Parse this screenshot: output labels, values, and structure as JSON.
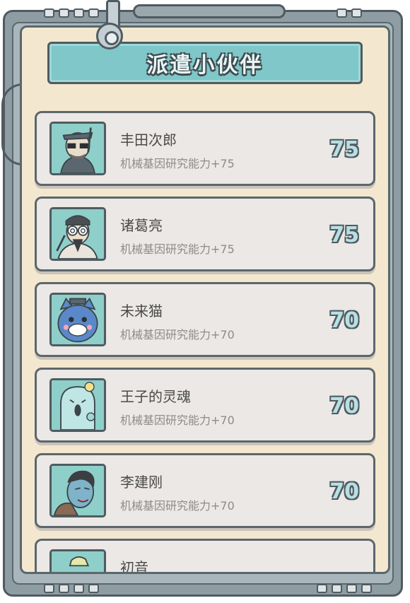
{
  "title": "派遣小伙伴",
  "partners": [
    {
      "name": "丰田次郎",
      "skill": "机械基因研究能力+75",
      "score": "75",
      "avatar": "sunglasses-man-avatar"
    },
    {
      "name": "诸葛亮",
      "skill": "机械基因研究能力+75",
      "score": "75",
      "avatar": "spiral-glasses-man-avatar"
    },
    {
      "name": "未来猫",
      "skill": "机械基因研究能力+70",
      "score": "70",
      "avatar": "blue-cat-avatar"
    },
    {
      "name": "王子的灵魂",
      "skill": "机械基因研究能力+70",
      "score": "70",
      "avatar": "ghost-avatar"
    },
    {
      "name": "李建刚",
      "skill": "机械基因研究能力+70",
      "score": "70",
      "avatar": "blue-face-man-avatar"
    },
    {
      "name": "初音",
      "skill": "",
      "score": "",
      "avatar": "green-hair-girl-avatar"
    }
  ],
  "colors": {
    "title_bar": "#7fc7c9",
    "panel": "#f3e8cf",
    "card": "#ebe8e5",
    "frame": "#8e9ca3"
  }
}
